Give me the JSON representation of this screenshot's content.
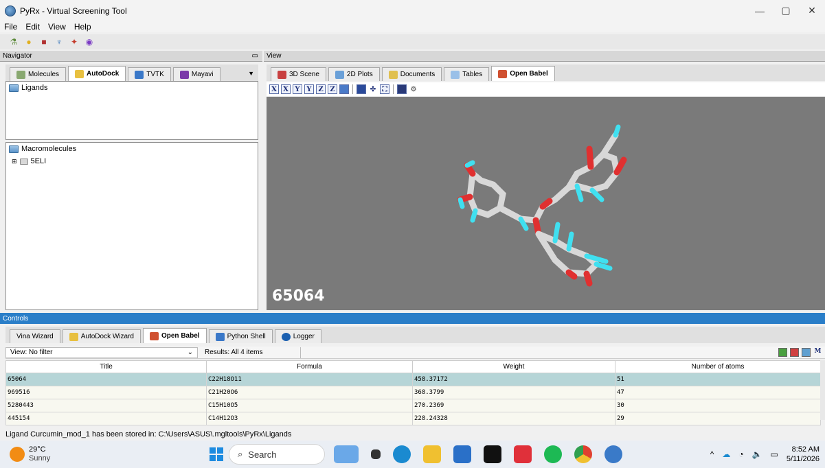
{
  "window": {
    "title": "PyRx - Virtual Screening Tool",
    "minimize": "—",
    "maximize": "▢",
    "close": "✕"
  },
  "menu": [
    "File",
    "Edit",
    "View",
    "Help"
  ],
  "navigator": {
    "header": "Navigator",
    "tabs": [
      "Molecules",
      "AutoDock",
      "TVTK",
      "Mayavi"
    ],
    "active_tab": "AutoDock",
    "ligands_label": "Ligands",
    "macromolecules_label": "Macromolecules",
    "macro_items": [
      "5ELI"
    ]
  },
  "view": {
    "header": "View",
    "tabs": [
      "3D Scene",
      "2D Plots",
      "Documents",
      "Tables",
      "Open Babel"
    ],
    "active_tab": "Open Babel",
    "toolbar_letters": [
      "X",
      "X",
      "Y",
      "Y",
      "Z",
      "Z"
    ],
    "scene_label": "65064"
  },
  "controls": {
    "header": "Controls",
    "tabs": [
      "Vina Wizard",
      "AutoDock Wizard",
      "Open Babel",
      "Python Shell",
      "Logger"
    ],
    "active_tab": "Open Babel",
    "view_filter": "View: No filter",
    "results": "Results: All 4 items",
    "columns": [
      "Title",
      "Formula",
      "Weight",
      "Number of atoms"
    ],
    "rows": [
      [
        "65064",
        "C22H18O11",
        "458.37172",
        "51"
      ],
      [
        "969516",
        "C21H20O6",
        "368.3799",
        "47"
      ],
      [
        "5280443",
        "C15H10O5",
        "270.2369",
        "30"
      ],
      [
        "445154",
        "C14H12O3",
        "228.24328",
        "29"
      ]
    ]
  },
  "status": "Ligand Curcumin_mod_1 has been stored in: C:\\Users\\ASUS\\.mgltools\\PyRx\\Ligands",
  "taskbar": {
    "temperature": "29°C",
    "condition": "Sunny",
    "search_placeholder": "Search",
    "time": "8:52 AM",
    "date": "5/11/2026"
  },
  "colors": {
    "controls_header": "#2a7ec8",
    "scene_bg": "#7a7a7a",
    "selected_row": "#b6d5d7"
  }
}
